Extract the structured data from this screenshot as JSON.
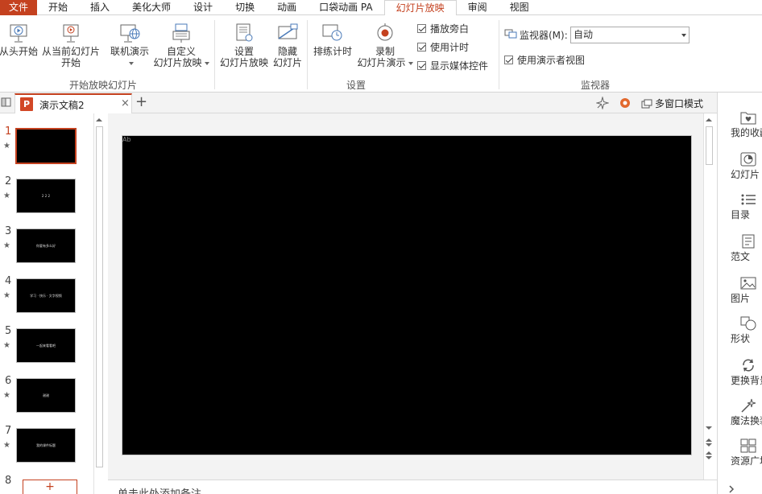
{
  "menu": {
    "tabs": [
      "文件",
      "开始",
      "插入",
      "美化大师",
      "设计",
      "切换",
      "动画",
      "口袋动画 PA",
      "幻灯片放映",
      "审阅",
      "视图"
    ],
    "active_index": 8
  },
  "ribbon": {
    "start_group": {
      "label": "开始放映幻灯片",
      "from_start": "从头开始",
      "from_current_line1": "从当前幻灯片",
      "from_current_line2": "开始",
      "online_present": "联机演示",
      "custom_line1": "自定义",
      "custom_line2": "幻灯片放映"
    },
    "setup_group": {
      "label": "设置",
      "setup_line1": "设置",
      "setup_line2": "幻灯片放映",
      "hide_line1": "隐藏",
      "hide_line2": "幻灯片",
      "rehearse": "排练计时",
      "record_line1": "录制",
      "record_line2": "幻灯片演示",
      "play_narrations": "播放旁白",
      "use_timings": "使用计时",
      "show_media_controls": "显示媒体控件"
    },
    "monitor_group": {
      "label": "监视器",
      "monitor_label": "监视器(M):",
      "monitor_value": "自动",
      "presenter_view": "使用演示者视图"
    }
  },
  "docbar": {
    "tab_title": "演示文稿2",
    "ppt_letter": "P",
    "close_glyph": "×",
    "new_tab_glyph": "+",
    "multi_window": "多窗口模式"
  },
  "thumbnails": [
    {
      "num": "1",
      "text": ""
    },
    {
      "num": "2",
      "text": "2 2 2"
    },
    {
      "num": "3",
      "text": "你要有多么好"
    },
    {
      "num": "4",
      "text": "学习 · 快乐 · 文字视频"
    },
    {
      "num": "5",
      "text": "一起来看看吧"
    },
    {
      "num": "6",
      "text": "谢谢"
    },
    {
      "num": "7",
      "text": "我的课件标题"
    },
    {
      "num": "8",
      "text": ""
    }
  ],
  "thumb_star": "★",
  "thumb_add_glyph": "+",
  "slide": {
    "corner_mark": "Ab"
  },
  "notes_placeholder": "单击此处添加备注",
  "right_panel": [
    {
      "label": "我的收藏",
      "icon": "heart-folder-icon"
    },
    {
      "label": "幻灯片",
      "icon": "slides-icon"
    },
    {
      "label": "目录",
      "icon": "list-icon"
    },
    {
      "label": "范文",
      "icon": "document-icon"
    },
    {
      "label": "图片",
      "icon": "picture-icon"
    },
    {
      "label": "形状",
      "icon": "shapes-icon"
    },
    {
      "label": "更换背景",
      "icon": "refresh-icon"
    },
    {
      "label": "魔法换装",
      "icon": "magic-wand-icon"
    },
    {
      "label": "资源广场",
      "icon": "grid-icon"
    }
  ],
  "colors": {
    "accent": "#c4411f",
    "slide_bg": "#000000",
    "edit_bg": "#f3f3f3"
  }
}
